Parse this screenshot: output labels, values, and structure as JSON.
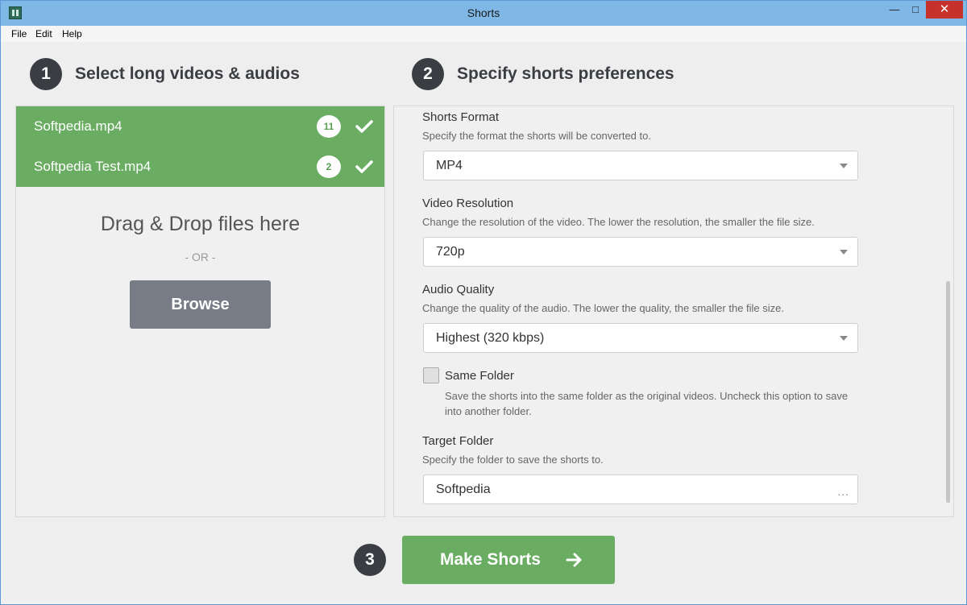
{
  "window": {
    "title": "Shorts"
  },
  "menu": [
    "File",
    "Edit",
    "Help"
  ],
  "step1": {
    "number": "1",
    "title": "Select long videos & audios"
  },
  "step2": {
    "number": "2",
    "title": "Specify shorts preferences"
  },
  "step3": {
    "number": "3"
  },
  "files": [
    {
      "name": "Softpedia.mp4",
      "count": "11"
    },
    {
      "name": "Softpedia Test.mp4",
      "count": "2"
    }
  ],
  "drop": {
    "text": "Drag & Drop files here",
    "or": "- OR -",
    "browse": "Browse"
  },
  "prefs": {
    "format": {
      "title": "Shorts Format",
      "desc": "Specify the format the shorts will be converted to.",
      "value": "MP4"
    },
    "resolution": {
      "title": "Video Resolution",
      "desc": "Change the resolution of the video. The lower the resolution, the smaller the file size.",
      "value": "720p"
    },
    "audio": {
      "title": "Audio Quality",
      "desc": "Change the quality of the audio. The lower the quality, the smaller the file size.",
      "value": "Highest (320 kbps)"
    },
    "same_folder": {
      "label": "Same Folder",
      "desc": "Save the shorts into the same folder as the original videos. Uncheck this option to save into another folder.",
      "checked": false
    },
    "target": {
      "title": "Target Folder",
      "desc": "Specify the folder to save the shorts to.",
      "value": "Softpedia",
      "browse_glyph": "..."
    }
  },
  "make_button": {
    "label": "Make Shorts"
  },
  "colors": {
    "green": "#6aad62",
    "dark": "#3a3d42",
    "browse": "#787c87",
    "titlebar": "#7fb8e6"
  }
}
